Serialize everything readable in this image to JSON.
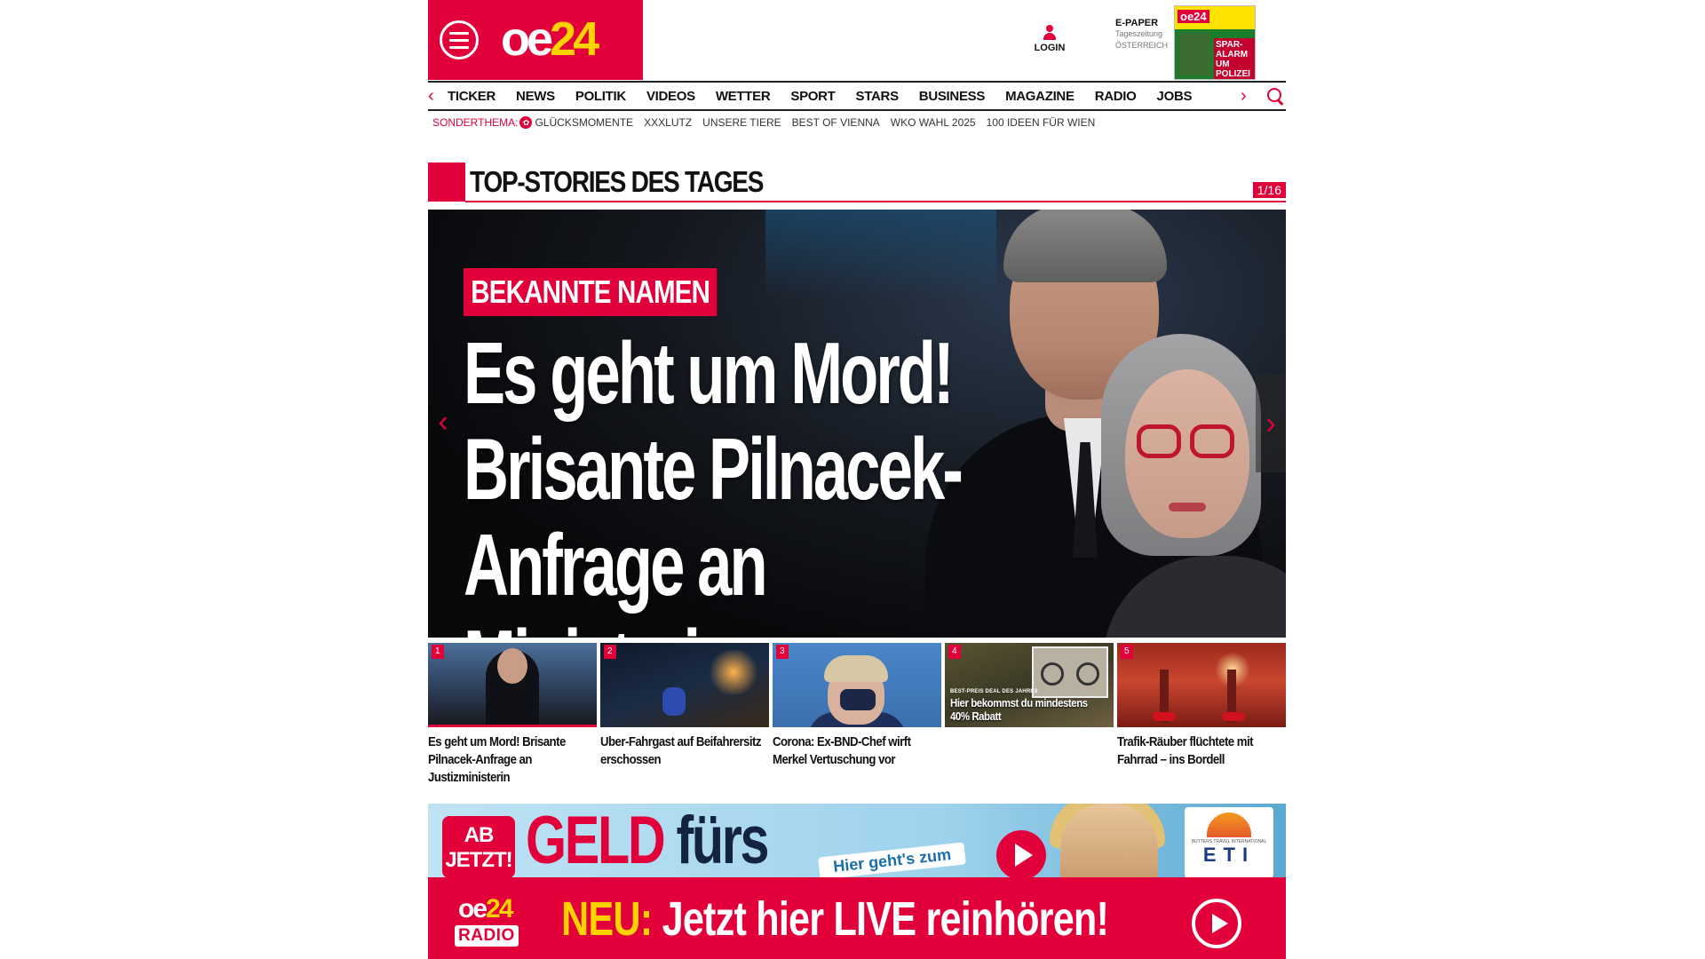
{
  "header": {
    "logo_oe": "oe",
    "logo_24": "24",
    "login_label": "LOGIN",
    "epaper_title": "E-PAPER",
    "epaper_sub1": "Tageszeitung",
    "epaper_sub2": "ÖSTERREICH",
    "epaper_cover_logo": "oe24",
    "epaper_cover_headline": "SPAR-ALARM UM POLIZEI"
  },
  "nav": {
    "items": [
      "TICKER",
      "NEWS",
      "POLITIK",
      "VIDEOS",
      "WETTER",
      "SPORT",
      "STARS",
      "BUSINESS",
      "MAGAZINE",
      "RADIO",
      "JOBS"
    ],
    "left_arrow": "‹",
    "right_arrow": "›"
  },
  "sonderthema": {
    "label": "SONDERTHEMA:",
    "items": [
      "GLÜCKSMOMENTE",
      "XXXLUTZ",
      "UNSERE TIERE",
      "BEST OF VIENNA",
      "WKO WAHL 2025",
      "100 IDEEN FÜR WIEN"
    ]
  },
  "section": {
    "title": "TOP-STORIES DES TAGES",
    "counter": "1/16"
  },
  "hero": {
    "kicker": "BEKANNTE NAMEN",
    "headline": "Es geht um Mord! Brisante Pilnacek-Anfrage an Ministerin",
    "prev": "‹",
    "next": "›"
  },
  "thumbs": [
    {
      "num": "1",
      "caption": "Es geht um Mord! Brisante Pilnacek-Anfrage an Justizministerin"
    },
    {
      "num": "2",
      "caption": "Uber-Fahrgast auf Beifahrersitz erschossen"
    },
    {
      "num": "3",
      "caption": "Corona: Ex-BND-Chef wirft Merkel Vertuschung vor"
    },
    {
      "num": "4",
      "caption": "",
      "overlay_small": "BEST-PREIS DEAL DES JAHRES",
      "overlay": "Hier bekommst du mindestens 40% Rabatt"
    },
    {
      "num": "5",
      "caption": "Trafik-Räuber flüchtete mit Fahrrad – ins Bordell"
    }
  ],
  "ad": {
    "ab_jetzt": "AB JETZT!",
    "geld": "GELD",
    "fuers": "fürs",
    "hier": "Hier geht's zum",
    "eti_small": "BUTTERS TRAVEL INTERNATIONAL",
    "eti": "ETI"
  },
  "radio": {
    "logo_oe": "oe",
    "logo_24": "24",
    "logo_radio": "RADIO",
    "neu": "NEU:",
    "message": " Jetzt hier LIVE reinhören!"
  },
  "colors": {
    "brand_red": "#e2003a",
    "brand_yellow": "#ffd200"
  }
}
